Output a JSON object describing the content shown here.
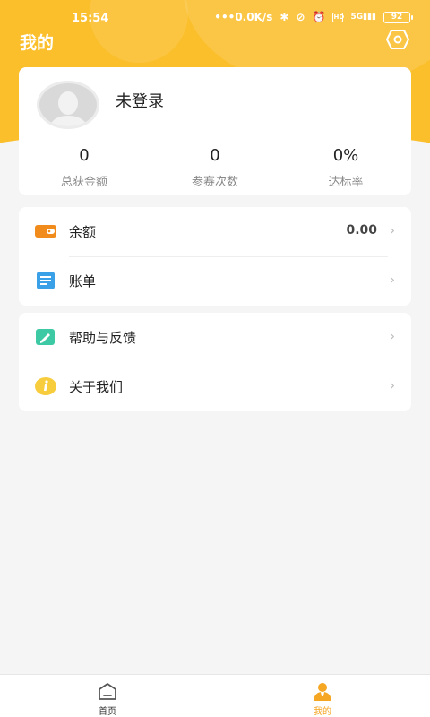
{
  "status_bar": {
    "time": "15:54",
    "network_speed": "0.0K/s",
    "network_type": "5G",
    "battery": "92",
    "hd_badge": "HD"
  },
  "header": {
    "title": "我的"
  },
  "profile": {
    "login_status": "未登录",
    "stats": [
      {
        "value": "0",
        "label": "总获金额"
      },
      {
        "value": "0",
        "label": "参赛次数"
      },
      {
        "value": "0%",
        "label": "达标率"
      }
    ]
  },
  "menu_group_1": [
    {
      "label": "余额",
      "value": "0.00",
      "icon": "wallet-icon"
    },
    {
      "label": "账单",
      "value": "",
      "icon": "bill-icon"
    }
  ],
  "menu_group_2": [
    {
      "label": "帮助与反馈",
      "value": "",
      "icon": "edit-icon"
    },
    {
      "label": "关于我们",
      "value": "",
      "icon": "info-icon"
    }
  ],
  "tabbar": {
    "items": [
      {
        "label": "首页",
        "icon": "home-icon"
      },
      {
        "label": "我的",
        "icon": "user-icon"
      }
    ]
  },
  "colors": {
    "accent": "#fbbf2c",
    "active_tab": "#f5a623",
    "wallet": "#f08b1c",
    "bill": "#3aa0e8",
    "edit": "#3cc9a3",
    "info": "#f7cd3d"
  }
}
